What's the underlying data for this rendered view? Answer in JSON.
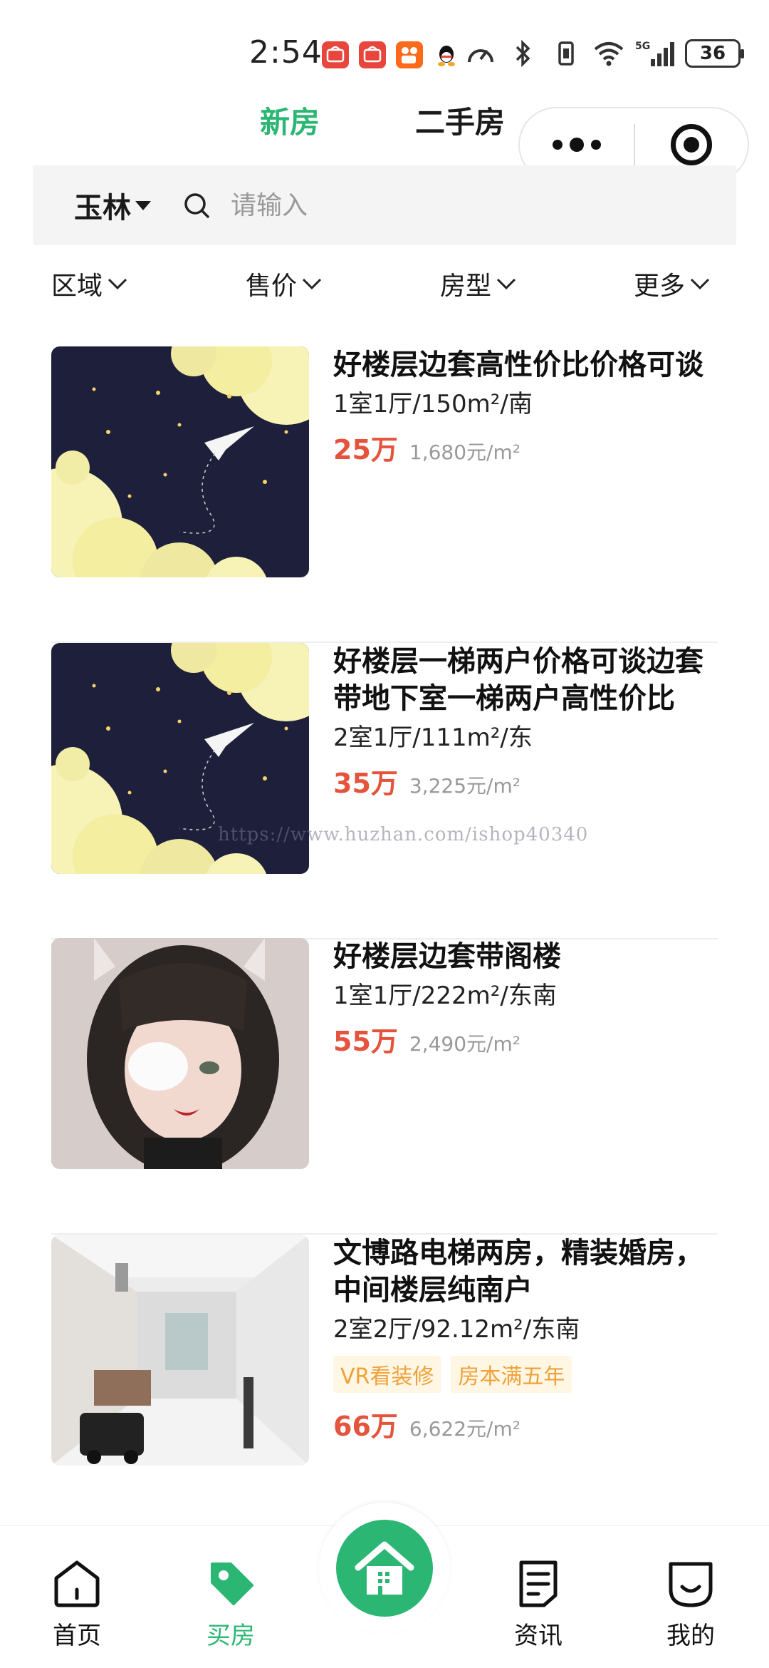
{
  "status_bar": {
    "time": "2:54",
    "battery": "36",
    "app_icons": [
      "huawei-store-icon",
      "huawei-store-icon",
      "kuaishou-icon",
      "qq-icon"
    ],
    "indicator_icons": [
      "speed-icon",
      "bluetooth-icon",
      "vibrate-icon",
      "wifi-icon",
      "5g-signal-icon"
    ]
  },
  "top_tabs": [
    {
      "label": "新房",
      "active": true
    },
    {
      "label": "二手房",
      "active": false
    }
  ],
  "search": {
    "city": "玉林",
    "placeholder": "请输入"
  },
  "filters": [
    {
      "label": "区域"
    },
    {
      "label": "售价"
    },
    {
      "label": "房型"
    },
    {
      "label": "更多"
    }
  ],
  "listings": [
    {
      "title": "好楼层边套高性价比价格可谈",
      "spec": "1室1厅/150m²/南",
      "tags": [],
      "price": "25万",
      "unit_price": "1,680元/m²",
      "image": "night-sky-paper-plane"
    },
    {
      "title": "好楼层一梯两户价格可谈边套带地下室一梯两户高性价比",
      "spec": "2室1厅/111m²/东",
      "tags": [],
      "price": "35万",
      "unit_price": "3,225元/m²",
      "image": "night-sky-paper-plane"
    },
    {
      "title": "好楼层边套带阁楼",
      "spec": "1室1厅/222m²/东南",
      "tags": [],
      "price": "55万",
      "unit_price": "2,490元/m²",
      "image": "portrait-girl"
    },
    {
      "title": "文博路电梯两房，精装婚房，中间楼层纯南户",
      "spec": "2室2厅/92.12m²/东南",
      "tags": [
        "VR看装修",
        "房本满五年"
      ],
      "price": "66万",
      "unit_price": "6,622元/m²",
      "image": "apartment-interior"
    }
  ],
  "watermark": "https://www.huzhan.com/ishop40340",
  "bottom_nav": [
    {
      "label": "首页",
      "icon": "home-icon",
      "active": false
    },
    {
      "label": "买房",
      "icon": "price-tag-icon",
      "active": true
    },
    {
      "label": "",
      "icon": "house-fab-icon",
      "active": false
    },
    {
      "label": "资讯",
      "icon": "news-icon",
      "active": false
    },
    {
      "label": "我的",
      "icon": "profile-icon",
      "active": false
    }
  ],
  "colors": {
    "accent": "#2bb673",
    "price": "#e5533c",
    "tag_bg": "#fff6e4",
    "tag_text": "#f0a23a"
  }
}
